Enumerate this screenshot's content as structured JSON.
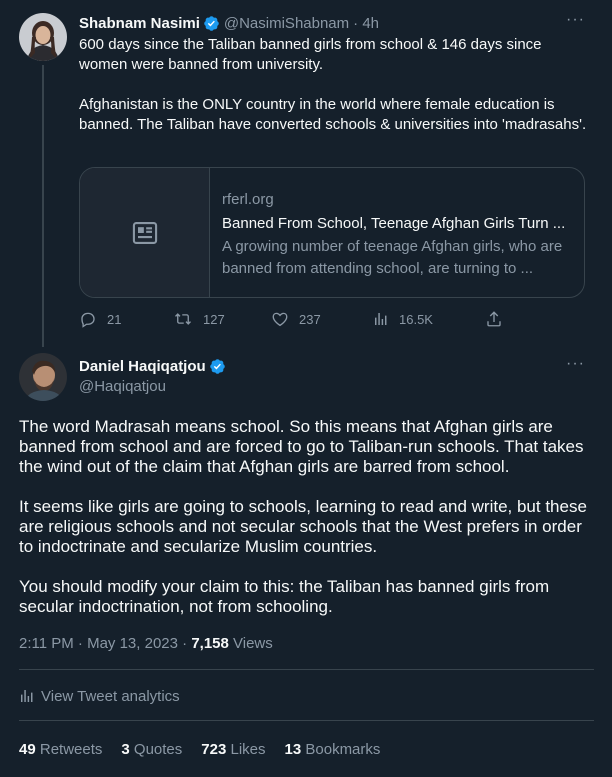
{
  "reply_tweet": {
    "author_name": "Shabnam Nasimi",
    "author_handle": "@NasimiShabnam",
    "time": "· 4h",
    "text_p1": "600 days since the Taliban banned girls from school & 146 days since women were banned from university.",
    "text_p2": "Afghanistan is the ONLY country in the world where female education is banned. The Taliban have converted schools & universities into 'madrasahs'.",
    "card": {
      "domain": "rferl.org",
      "title": "Banned From School, Teenage Afghan Girls Turn ...",
      "description": "A growing number of teenage Afghan girls, who are banned from attending school, are turning to ..."
    },
    "actions": {
      "replies": "21",
      "retweets": "127",
      "likes": "237",
      "views": "16.5K"
    }
  },
  "main_tweet": {
    "author_name": "Daniel Haqiqatjou",
    "author_handle": "@Haqiqatjou",
    "paragraphs": [
      "The word Madrasah means school. So this means that Afghan girls are banned from school and are forced to go to Taliban-run schools. That takes the wind out of the claim that Afghan girls are barred from school.",
      "It seems like girls are going to schools, learning to read and write, but these are religious schools and not secular schools that the West prefers in order to indoctrinate and secularize Muslim countries.",
      "You should modify your claim to this: the Taliban has banned girls from secular indoctrination, not from schooling."
    ],
    "timestamp": "2:11 PM · May 13, 2023 · ",
    "views_count": "7,158",
    "views_label": " Views",
    "analytics_label": "View Tweet analytics",
    "stats": {
      "retweets_count": "49",
      "retweets_label": "Retweets",
      "quotes_count": "3",
      "quotes_label": "Quotes",
      "likes_count": "723",
      "likes_label": "Likes",
      "bookmarks_count": "13",
      "bookmarks_label": "Bookmarks"
    }
  },
  "icons": [
    "verified-badge-icon",
    "more-icon",
    "news-article-icon",
    "reply-icon",
    "retweet-icon",
    "like-icon",
    "views-icon",
    "share-icon",
    "analytics-icon"
  ],
  "colors": {
    "background": "#15202b",
    "text": "#f7f9f9",
    "muted": "#8b98a5",
    "border": "#38444d",
    "verified": "#1d9bf0"
  }
}
